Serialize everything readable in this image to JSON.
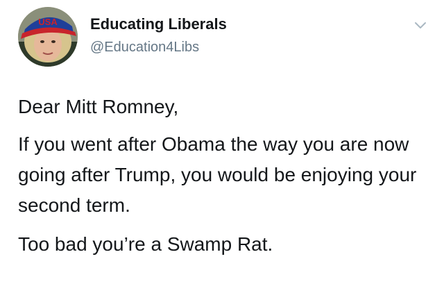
{
  "tweet": {
    "author": {
      "display_name": "Educating Liberals",
      "handle": "@Education4Libs",
      "avatar_hat_text": "USA"
    },
    "menu_icon": "chevron-down-icon",
    "body": {
      "salutation": "Dear Mitt Romney,",
      "paragraph_1": "If you went after Obama the way you are now going after Trump, you would be enjoying your second term.",
      "paragraph_2": "Too bad you’re a Swamp Rat."
    }
  },
  "colors": {
    "text": "#14171a",
    "secondary_text": "#657786",
    "chevron": "#aab8c2",
    "background": "#ffffff"
  }
}
